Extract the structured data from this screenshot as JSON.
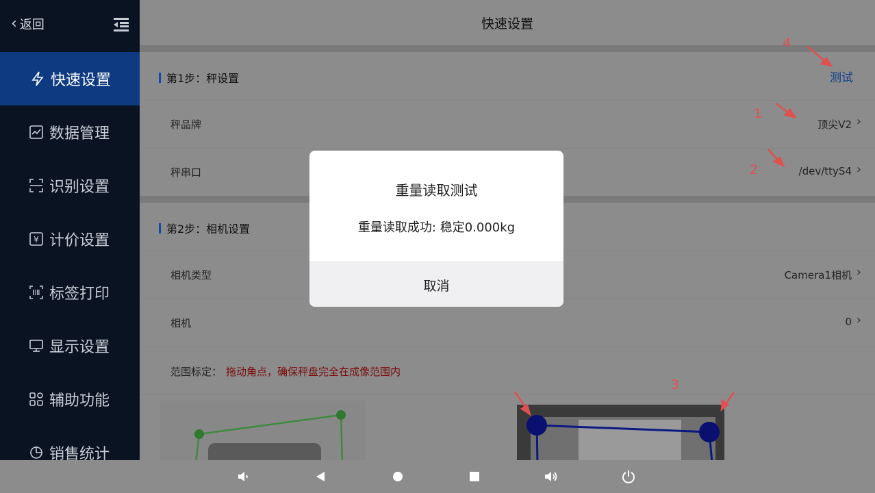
{
  "sidebar": {
    "back_label": "返回",
    "items": [
      {
        "label": "快速设置",
        "icon": "lightning-icon",
        "active": true
      },
      {
        "label": "数据管理",
        "icon": "chart-icon"
      },
      {
        "label": "识别设置",
        "icon": "scan-icon"
      },
      {
        "label": "计价设置",
        "icon": "yen-icon"
      },
      {
        "label": "标签打印",
        "icon": "barcode-icon"
      },
      {
        "label": "显示设置",
        "icon": "monitor-icon"
      },
      {
        "label": "辅助功能",
        "icon": "grid-icon"
      },
      {
        "label": "销售统计",
        "icon": "pie-icon"
      }
    ]
  },
  "header": {
    "title": "快速设置"
  },
  "step1": {
    "title": "第1步：秤设置",
    "test_label": "测试",
    "rows": [
      {
        "label": "秤品牌",
        "value": "顶尖V2"
      },
      {
        "label": "秤串口",
        "value": "/dev/ttyS4"
      }
    ]
  },
  "step2": {
    "title": "第2步：相机设置",
    "rows": [
      {
        "label": "相机类型",
        "value": "Camera1相机"
      },
      {
        "label": "相机",
        "value": "0"
      }
    ],
    "calib_label": "范围标定：",
    "calib_hint": "拖动角点，确保秤盘完全在成像范围内"
  },
  "annotations": [
    "1",
    "2",
    "3",
    "4"
  ],
  "modal": {
    "title": "重量读取测试",
    "message": "重量读取成功: 稳定0.000kg",
    "cancel_label": "取消"
  },
  "colors": {
    "accent": "#0d3a80",
    "sidebar_bg": "#0a1322",
    "annotation": "#e05050",
    "hint_red": "#7a0a0a"
  }
}
